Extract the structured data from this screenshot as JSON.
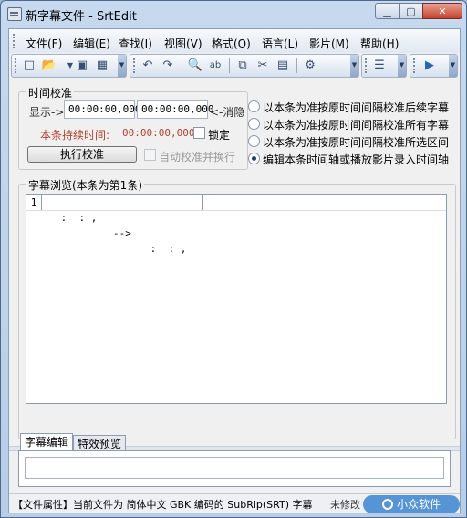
{
  "window": {
    "title": "新字幕文件 - SrtEdit"
  },
  "window_controls": {
    "minimize": "▁",
    "maximize": "▢",
    "close": "✕"
  },
  "menu": [
    "文件(F)",
    "编辑(E)",
    "查找(I)",
    "视图(V)",
    "格式(O)",
    "语言(L)",
    "影片(M)",
    "帮助(H)"
  ],
  "toolbar_icons": [
    "new-file",
    "open-folder",
    "save",
    "save-all",
    "undo",
    "redo",
    "find",
    "replace",
    "copy",
    "cut",
    "paste",
    "options",
    "list",
    "play"
  ],
  "time_calibration": {
    "group_label": "时间校准",
    "display_label": "显示->",
    "start_time": "00:00:00,000",
    "end_time": "00:00:00,000",
    "cancel_label": "<-消隐",
    "duration_label": "本条持续时间:",
    "duration_value": "00:00:00,000",
    "lock_label": "锁定",
    "execute_button": "执行校准",
    "auto_label": "自动校准并换行"
  },
  "calibration_modes": {
    "selected_index": 3,
    "options": [
      "以本条为准按原时间间隔校准后续字幕",
      "以本条为准按原时间间隔校准所有字幕",
      "以本条为准按原时间间隔校准所选区间",
      "编辑本条时间轴或播放影片录入时间轴"
    ]
  },
  "subtitle_browse": {
    "group_label": "字幕浏览(本条为第1条)",
    "rows": [
      {
        "index": "1",
        "start": " :  : ,",
        "arrow": "-->",
        "end": " :  : ,"
      }
    ]
  },
  "bottom_tabs": {
    "edit_tab": "字幕编辑",
    "preview_tab": "特效预览"
  },
  "status": {
    "text": "【文件属性】当前文件为 简体中文 GBK 编码的 SubRip(SRT) 字幕",
    "modified": "未修改"
  },
  "watermark": {
    "text": "小众软件"
  },
  "colors": {
    "duration_red": "#b0412e",
    "accent_blue": "#4a8fd4"
  }
}
